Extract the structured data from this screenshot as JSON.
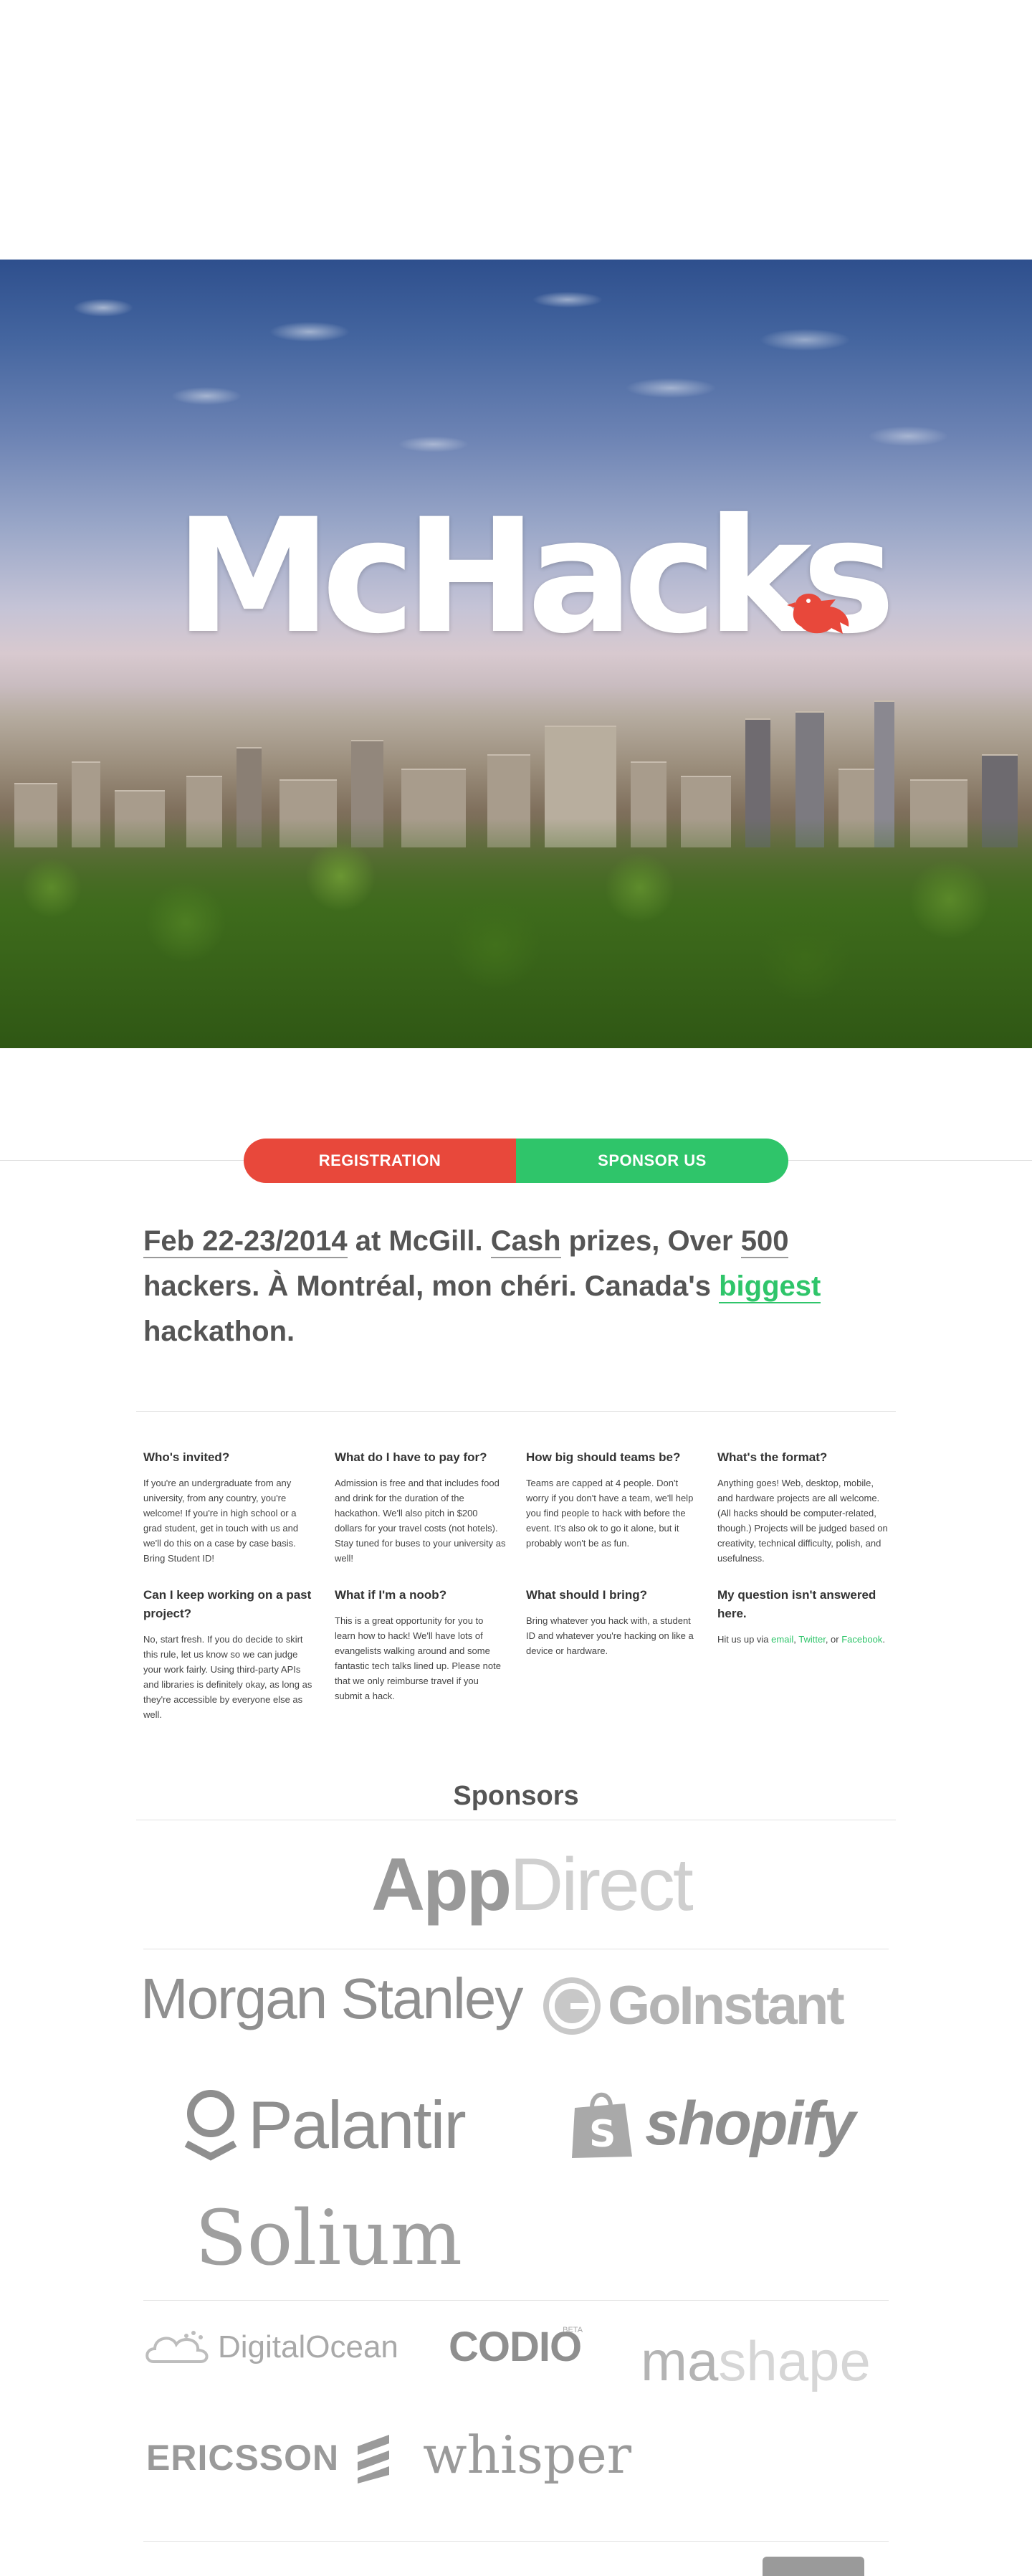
{
  "hero": {
    "logo_text": "McHacks"
  },
  "cta": {
    "registration_label": "REGISTRATION",
    "sponsor_label": "SPONSOR US"
  },
  "intro": {
    "part1": "Feb 22-23/2014",
    "part2": " at McGill. ",
    "part3": "Cash",
    "part4": " prizes, Over ",
    "part5": "500",
    "part6": " hackers. À Montréal, mon chéri. Canada's ",
    "part7": "biggest",
    "part8": " hackathon."
  },
  "faq": [
    {
      "q": "Who's invited?",
      "a": "If you're an undergraduate from any university, from any country, you're welcome! If you're in high school or a grad student, get in touch with us and we'll do this on a case by case basis. Bring Student ID!"
    },
    {
      "q": "What do I have to pay for?",
      "a": "Admission is free and that includes food and drink for the duration of the hackathon. We'll also pitch in $200 dollars for your travel costs (not hotels). Stay tuned for buses to your university as well!"
    },
    {
      "q": "How big should teams be?",
      "a": "Teams are capped at 4 people. Don't worry if you don't have a team, we'll help you find people to hack with before the event. It's also ok to go it alone, but it probably won't be as fun."
    },
    {
      "q": "What's the format?",
      "a": "Anything goes! Web, desktop, mobile, and hardware projects are all welcome. (All hacks should be computer-related, though.) Projects will be judged based on creativity, technical difficulty, polish, and usefulness."
    },
    {
      "q": "Can I keep working on a past project?",
      "a": "No, start fresh. If you do decide to skirt this rule, let us know so we can judge your work fairly. Using third-party APIs and libraries is definitely okay, as long as they're accessible by everyone else as well."
    },
    {
      "q": "What if I'm a noob?",
      "a": "This is a great opportunity for you to learn how to hack! We'll have lots of evangelists walking around and some fantastic tech talks lined up. Please note that we only reimburse travel if you submit a hack."
    },
    {
      "q": "What should I bring?",
      "a": "Bring whatever you hack with, a student ID and whatever you're hacking on like a device or hardware."
    },
    {
      "q": "My question isn't answered here.",
      "a_prefix": "Hit us up via ",
      "email": "email",
      "sep1": ", ",
      "twitter": "Twitter",
      "sep2": ", or ",
      "facebook": "Facebook",
      "end": "."
    }
  ],
  "sponsors": {
    "title": "Sponsors",
    "appdirect_a": "App",
    "appdirect_b": "Direct",
    "morgan": "Morgan Stanley",
    "goinstant": "GoInstant",
    "palantir": "Palantir",
    "shopify": "shopify",
    "solium": "Solium",
    "digitalocean": "DigitalOcean",
    "codio": "CODIO",
    "codio_beta": "BETA",
    "mashape_a": "ma",
    "mashape_b": "shape",
    "ericsson": "ERICSSON",
    "whisper": "whisper"
  },
  "colors": {
    "red": "#e8483b",
    "green": "#2fc56a",
    "text": "#555555"
  }
}
